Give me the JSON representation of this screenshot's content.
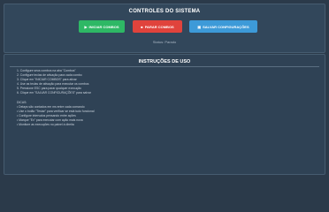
{
  "header": {
    "title": "CONTROLES DO SISTEMA",
    "buttons": {
      "start_label": "INICIAR COMBOS",
      "stop_label": "PARAR COMBOS",
      "save_label": "SALVAR CONFIGURAÇÕES"
    },
    "status": "Status: Parado"
  },
  "instructions": {
    "title": "INSTRUÇÕES DE USO",
    "steps": [
      "1. Configure seus combos na aba \"Combos\"",
      "2. Configure teclas de ativação para cada combo",
      "3. Clique em \"INICIAR COMBOS\" para ativar",
      "4. Use as teclas de ativação para executar os combos",
      "5. Pressione ESC para parar qualquer execução",
      "6. Clique em \"SALVAR CONFIGURAÇÕES\" para salvar"
    ],
    "tips_title": "DICAS:",
    "tips": [
      "• Delays são contados em ms entre cada comando",
      "• Use o botão \"Testar\" para verificar se está tudo funcional",
      "• Configure intervalos pensando entre ações",
      "• Marque \"Ex\" para executar com ação mais nova",
      "• Monitore as execuções no painel à direita"
    ]
  }
}
